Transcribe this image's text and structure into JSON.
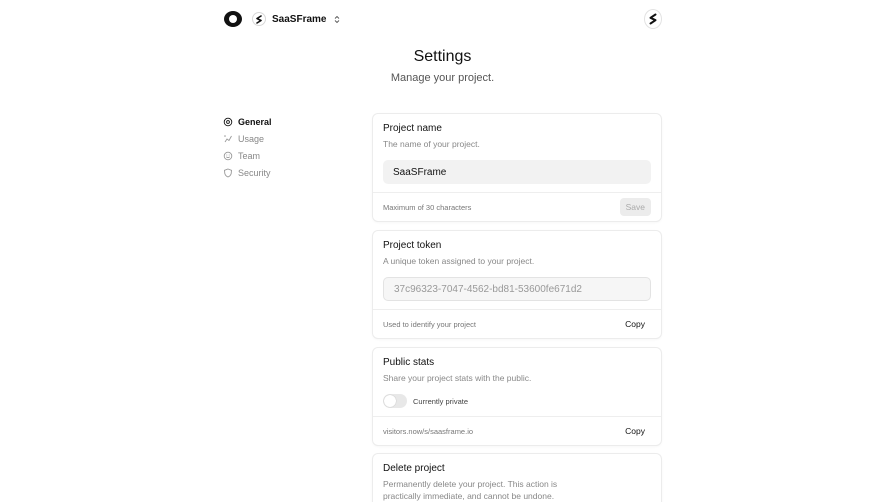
{
  "topbar": {
    "project_name": "SaaSFrame",
    "logo_icon": "app-logo-icon",
    "project_avatar_icon": "saasframe-logo-icon",
    "switch_icon": "chevron-up-down-icon",
    "user_avatar_icon": "user-avatar-icon"
  },
  "header": {
    "title": "Settings",
    "subtitle": "Manage your project."
  },
  "sidebar": {
    "items": [
      {
        "label": "General",
        "icon": "gear-icon",
        "active": true
      },
      {
        "label": "Usage",
        "icon": "usage-icon",
        "active": false
      },
      {
        "label": "Team",
        "icon": "smile-icon",
        "active": false
      },
      {
        "label": "Security",
        "icon": "shield-icon",
        "active": false
      }
    ]
  },
  "cards": {
    "project_name": {
      "title": "Project name",
      "description": "The name of your project.",
      "value": "SaaSFrame",
      "footer": "Maximum of 30 characters",
      "button": "Save"
    },
    "project_token": {
      "title": "Project token",
      "description": "A unique token assigned to your project.",
      "value": "37c96323-7047-4562-bd81-53600fe671d2",
      "footer": "Used to identify your project",
      "button": "Copy"
    },
    "public_stats": {
      "title": "Public stats",
      "description": "Share your project stats with the public.",
      "toggle_label": "Currently private",
      "footer": "visitors.now/s/saasframe.io",
      "button": "Copy"
    },
    "delete_project": {
      "title": "Delete project",
      "description": "Permanently delete your project. This action is practically immediate, and cannot be undone."
    }
  }
}
